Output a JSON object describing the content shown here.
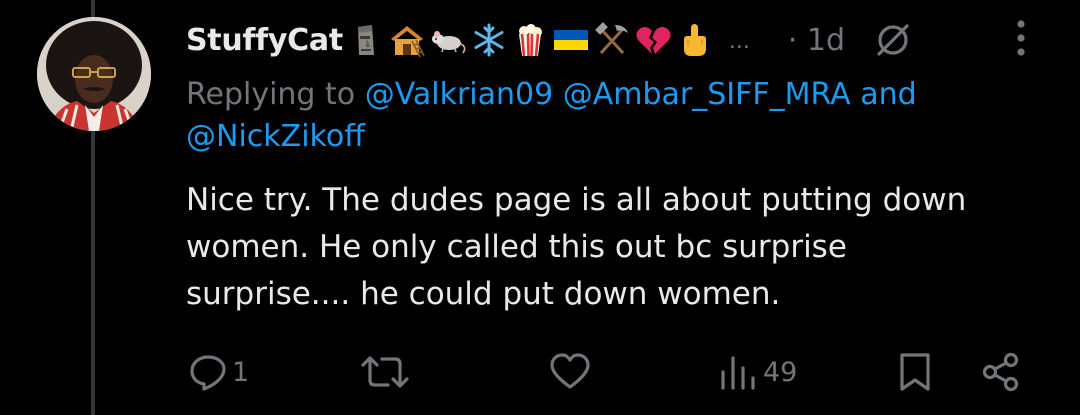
{
  "tweet": {
    "username": "StuffyCat",
    "display_emojis": [
      "moai",
      "house-with-ladder",
      "rat",
      "snowflake",
      "popcorn",
      "ukraine-flag",
      "hammer-and-pick",
      "broken-heart",
      "middle-finger"
    ],
    "ellipsis": "...",
    "time": "· 1d",
    "replying_prefix": "Replying to",
    "mentions_line1": "@Valkrian09 @Ambar_SIFF_MRA",
    "and_word": " and",
    "mentions_line2": "@NickZikoff",
    "body_lines": [
      "Nice try. The dudes page is all about putting down",
      "women. He only called this out bc surprise",
      "surprise.... he could put down women."
    ]
  },
  "actions": {
    "reply_count": "1",
    "views_count": "49"
  },
  "colors": {
    "background": "#000000",
    "primary_text": "#e7e9ea",
    "secondary_text": "#71767b",
    "mention_blue": "#1d9bf0",
    "thread_line": "#333639"
  },
  "icons": [
    "mute-icon",
    "more-icon",
    "reply-icon",
    "retweet-icon",
    "like-icon",
    "views-icon",
    "bookmark-icon",
    "share-icon"
  ]
}
